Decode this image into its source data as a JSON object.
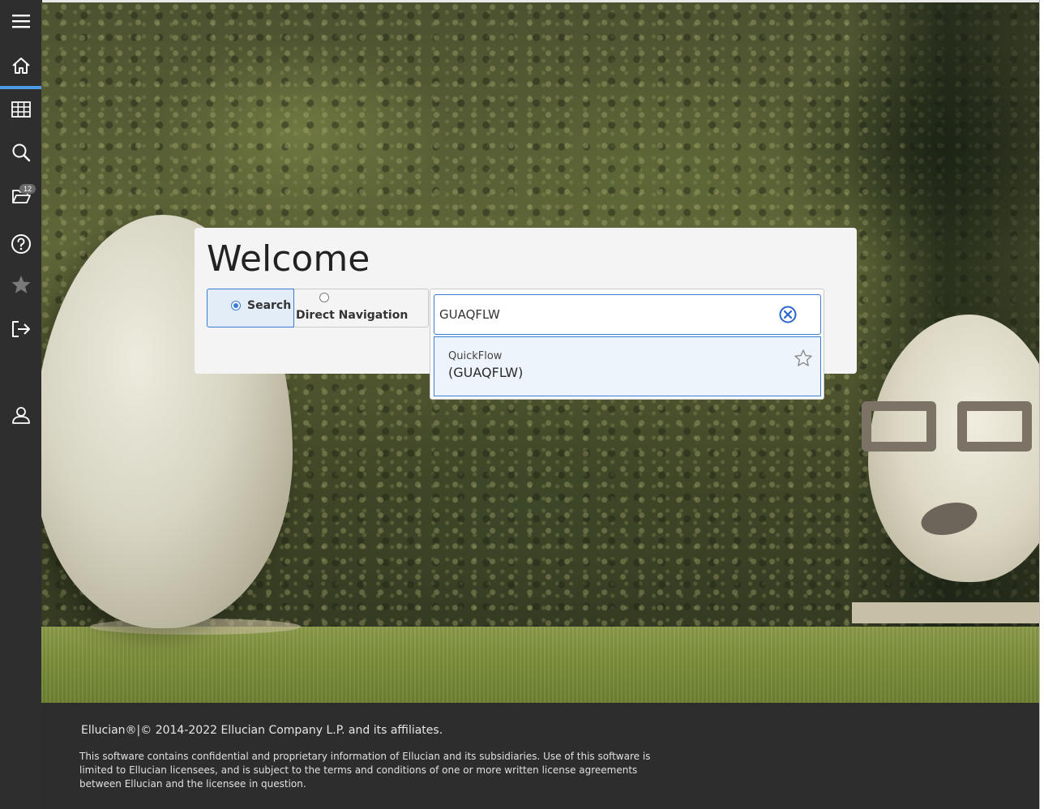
{
  "sidebar": {
    "items": [
      {
        "name": "menu",
        "icon": "hamburger-menu-icon"
      },
      {
        "name": "home",
        "icon": "home-icon",
        "active": true
      },
      {
        "name": "applications",
        "icon": "grid-icon"
      },
      {
        "name": "search",
        "icon": "search-icon"
      },
      {
        "name": "recently-opened",
        "icon": "folder-open-icon",
        "badge": "12"
      },
      {
        "name": "help",
        "icon": "help-circle-icon"
      },
      {
        "name": "favorites",
        "icon": "star-icon"
      },
      {
        "name": "sign-out",
        "icon": "sign-out-icon"
      },
      {
        "name": "user-profile",
        "icon": "user-icon"
      }
    ],
    "badge_count": "12"
  },
  "welcome": {
    "title": "Welcome",
    "modes": {
      "search_label": "Search",
      "direct_label": "Direct Navigation",
      "selected": "search"
    }
  },
  "search": {
    "value": "GUAQFLW",
    "clear_icon": "close-circle-icon",
    "results": [
      {
        "name": "QuickFlow",
        "code": "(GUAQFLW)",
        "favorite_icon": "star-outline-icon"
      }
    ]
  },
  "footer": {
    "copyright": "Ellucian®|© 2014-2022 Ellucian Company L.P. and its affiliates.",
    "disclaimer": "This software contains confidential and proprietary information of Ellucian and its subsidiaries. Use of this software is limited to Ellucian licensees, and is subject to the terms and conditions of one or more written license agreements between Ellucian and the licensee in question."
  },
  "colors": {
    "sidebar_bg": "#2e2e2e",
    "accent": "#3a7bd5",
    "active_indicator": "#4b9be8",
    "footer_bg": "#2d2d2d",
    "card_bg": "#f4f4f4"
  }
}
